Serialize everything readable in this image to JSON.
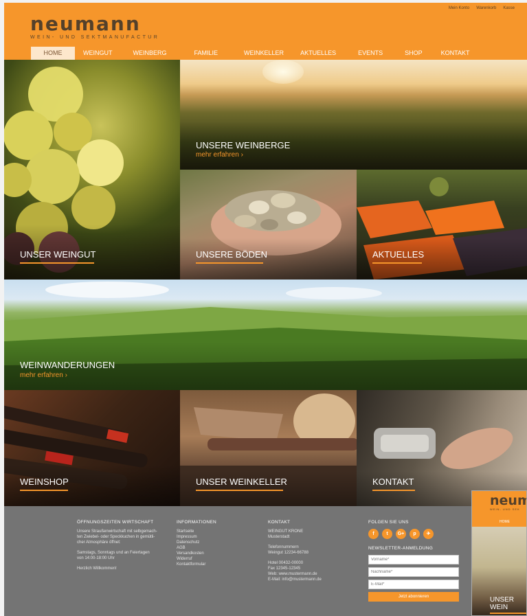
{
  "brand": {
    "name": "neumann",
    "tagline": "WEIN- UND SEKTMANUFACTUR"
  },
  "top_links": [
    "Mein Konto",
    "Warenkorb",
    "Kasse"
  ],
  "nav": [
    "HOME",
    "WEINGUT",
    "WEINBERG",
    "FAMILIE",
    "WEINKELLER",
    "AKTUELLES",
    "EVENTS",
    "SHOP",
    "KONTAKT"
  ],
  "tiles": {
    "weingut": "UNSER WEINGUT",
    "weinberge": "UNSERE WEINBERGE",
    "weinberge_more": "mehr erfahren ›",
    "boeden": "UNSERE BÖDEN",
    "aktuelles": "AKTUELLES",
    "wanderungen": "WEINWANDERUNGEN",
    "wanderungen_more": "mehr erfahren ›",
    "weinshop": "WEINSHOP",
    "weinkeller": "UNSER WEINKELLER",
    "kontakt": "KONTAKT"
  },
  "footer": {
    "hours_title": "ÖFFNUNGSZEITEN WIRTSCHAFT",
    "hours_1": "Unsere Straußenwirtschaft mit selbgemach-",
    "hours_2": "ten Zwiebel- oder Speckkuchen in gemütli-",
    "hours_3": "cher Atmosphäre öffnet:",
    "hours_4": "Samstags, Sonntags und an Feiertagen",
    "hours_5": "von 14:00-18:00 Uhr",
    "hours_6": "Herzlich Willkommen!",
    "info_title": "INFORMATIONEN",
    "info_links": [
      "Startseite",
      "Impressum",
      "Datenschutz",
      "AGB",
      "Versandkosten",
      "Widerruf",
      "Kontaktformular"
    ],
    "contact_title": "KONTAKT",
    "contact_1": "WEINGUT KRONE",
    "contact_2": "Musterstadt",
    "contact_3": "Telefonnummern",
    "contact_4": "Weingut 12234-66788",
    "contact_5": "Hotel 00432-00000",
    "contact_6": "Fax 12345-12345",
    "contact_7": "Web: www.mustermann.de",
    "contact_8": "E-Mail: info@mustermann.de",
    "follow_title": "FOLGEN SIE UNS",
    "social_icons": [
      "facebook-icon",
      "twitter-icon",
      "google-plus-icon",
      "pinterest-icon",
      "tripadvisor-icon"
    ],
    "social_glyphs": [
      "f",
      "t",
      "G+",
      "p",
      "✈"
    ],
    "newsletter_title": "NEWSLETTER-ANMELDUNG",
    "ph_vorname": "Vorname*",
    "ph_nachname": "Nachname*",
    "ph_email": "E-Mail*",
    "submit": "Jetzt abonnieren"
  },
  "thumb": {
    "logo": "neum",
    "caption": "UNSER WEIN",
    "nav": "HOME",
    "tag": "WEIN- UND SEK"
  },
  "colors": {
    "accent": "#f6962b",
    "footer": "#747474"
  }
}
